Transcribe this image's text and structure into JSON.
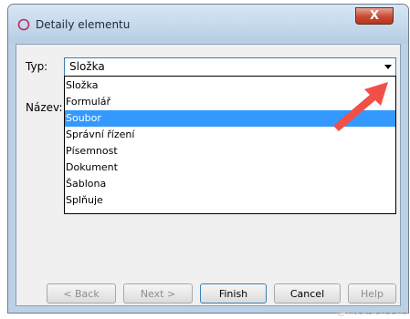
{
  "window": {
    "title": "Detaily elementu",
    "close_label": "X"
  },
  "form": {
    "typ_label": "Typ:",
    "nazev_label": "Název:",
    "typ_value": "Složka"
  },
  "dropdown": {
    "items": [
      "Složka",
      "Formulář",
      "Soubor",
      "Správní řízení",
      "Písemnost",
      "Dokument",
      "Šablona",
      "Splňuje"
    ],
    "selected_index": 2
  },
  "buttons": {
    "back": "< Back",
    "next": "Next >",
    "finish": "Finish",
    "cancel": "Cancel",
    "help": "Help"
  },
  "watermark": "@FastScreens",
  "colors": {
    "selection": "#3399ff",
    "annotation_arrow": "#f05048",
    "close_button": "#c74a32"
  }
}
